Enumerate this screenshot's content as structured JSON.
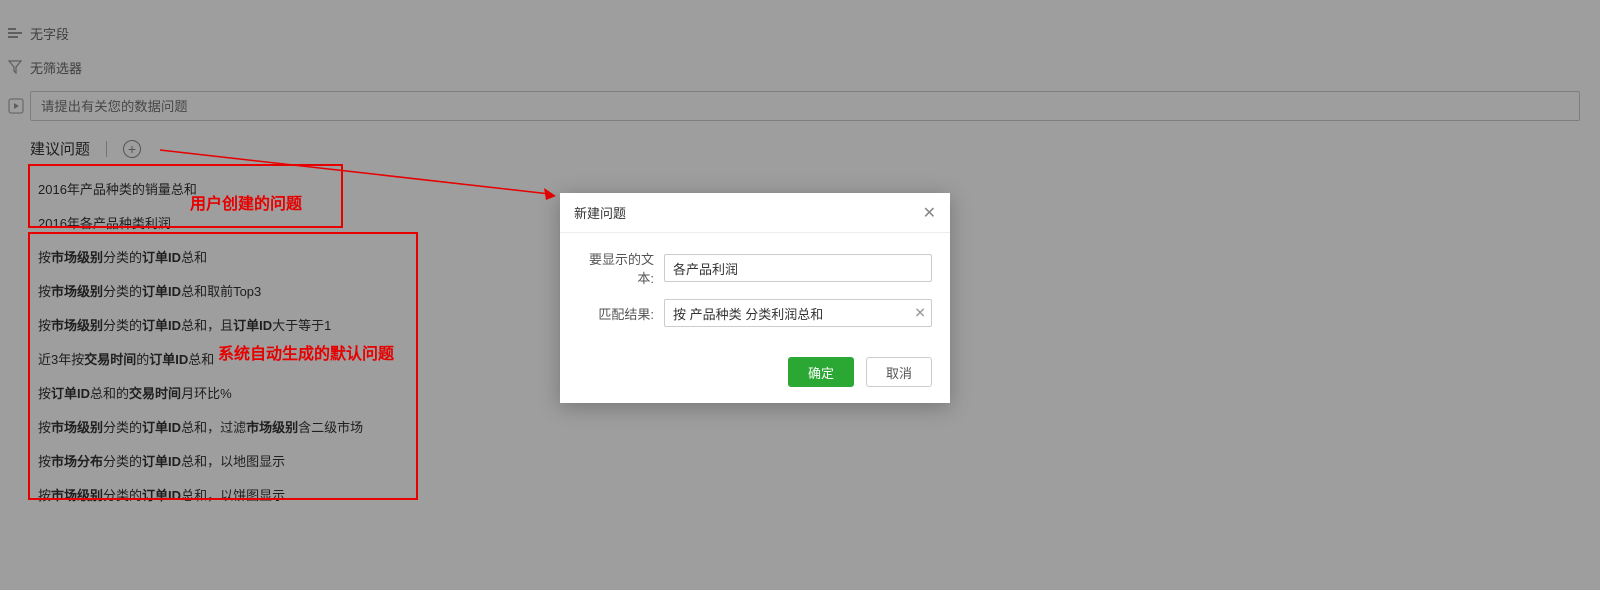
{
  "top": {
    "no_fields": "无字段",
    "no_filters": "无筛选器",
    "search_placeholder": "请提出有关您的数据问题"
  },
  "section": {
    "title": "建议问题"
  },
  "user_questions": [
    "2016年产品种类的销量总和",
    "2016年各产品种类利润"
  ],
  "system_questions": [
    "按<b>市场级别</b>分类的<b>订单ID</b>总和",
    "按<b>市场级别</b>分类的<b>订单ID</b>总和取前Top3",
    "按<b>市场级别</b>分类的<b>订单ID</b>总和，且<b>订单ID</b>大于等于1",
    "近3年按<b>交易时间</b>的<b>订单ID</b>总和",
    "按<b>订单ID</b>总和的<b>交易时间</b>月环比%",
    "按<b>市场级别</b>分类的<b>订单ID</b>总和，过滤<b>市场级别</b>含二级市场",
    "按<b>市场分布</b>分类的<b>订单ID</b>总和，以地图显示",
    "按<b>市场级别</b>分类的<b>订单ID</b>总和，以饼图显示"
  ],
  "annotations": {
    "user_created": "用户创建的问题",
    "system_generated": "系统自动生成的默认问题"
  },
  "modal": {
    "title": "新建问题",
    "label_text": "要显示的文本:",
    "label_match": "匹配结果:",
    "input_text_value": "各产品利润",
    "input_match_value": "按 产品种类 分类利润总和",
    "ok": "确定",
    "cancel": "取消"
  }
}
